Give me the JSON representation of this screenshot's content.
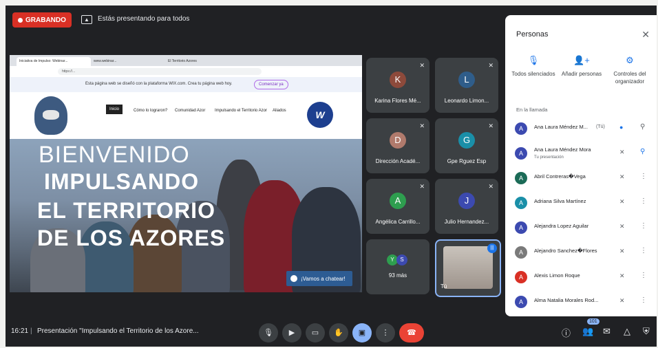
{
  "topbar": {
    "recording_label": "GRABANDO",
    "presenting_text": "Estás presentando para todos"
  },
  "slide": {
    "browser_tabs": [
      "Iniciativa de Impulso: Webinar...",
      "www.webinar...",
      "El Territorio Azores"
    ],
    "wix_banner": "Esta página web se diseñó con la plataforma WIX.com. Crea tu página web hoy.",
    "wix_button": "Comenzar ya",
    "nav": [
      "Inicio",
      "Cómo lo lograron?",
      "Comunidad Azor",
      "Impulsando el Territorio Azor",
      "Aliados"
    ],
    "hero_lines": [
      "BIENVENIDO",
      "IMPULSANDO",
      "EL TERRITORIO",
      "DE LOS AZORES"
    ],
    "chat_label": "¡Vamos a chatear!"
  },
  "tiles": [
    {
      "initial": "K",
      "name": "Karina Flores Mé...",
      "color": "#8d4a3b"
    },
    {
      "initial": "L",
      "name": "Leonardo Limon...",
      "color": "#2f5d8a"
    },
    {
      "initial": "D",
      "name": "Dirección Acadé...",
      "color": "#b07a6c"
    },
    {
      "initial": "G",
      "name": "Gpe Rguez Esp",
      "color": "#1a8fa8"
    },
    {
      "initial": "A",
      "name": "Angélica Carrillo...",
      "color": "#2e9e4f"
    },
    {
      "initial": "J",
      "name": "Julio Hernandez...",
      "color": "#3c4ab0"
    }
  ],
  "more_tile": {
    "avatars": [
      "Y",
      "S"
    ],
    "label": "93 más"
  },
  "self_tile": {
    "label": "Tú"
  },
  "people_panel": {
    "title": "Personas",
    "actions": [
      {
        "icon": "mic-off-icon",
        "label": "Todos silenciados"
      },
      {
        "icon": "add-person-icon",
        "label": "Añadir personas"
      },
      {
        "icon": "host-controls-icon",
        "label": "Controles del organizador"
      }
    ],
    "section_label": "En la llamada",
    "people": [
      {
        "initial": "A",
        "name": "Ana Laura Méndez M...",
        "tag": "(Tú)",
        "sub": "",
        "color": "#3c4ab0"
      },
      {
        "initial": "A",
        "name": "Ana Laura Méndez Mora",
        "tag": "",
        "sub": "Tu presentación",
        "color": "#3c4ab0"
      },
      {
        "initial": "A",
        "name": "Abril Contreras�Vega",
        "tag": "",
        "sub": "",
        "color": "#1b6b57"
      },
      {
        "initial": "A",
        "name": "Adriana Silva Martínez",
        "tag": "",
        "sub": "",
        "color": "#1a8fa8"
      },
      {
        "initial": "A",
        "name": "Alejandra Lopez Aguilar",
        "tag": "",
        "sub": "",
        "color": "#3c4ab0"
      },
      {
        "initial": "A",
        "name": "Alejandro Sanchez�Flores",
        "tag": "",
        "sub": "",
        "color": "#7a7a7a"
      },
      {
        "initial": "A",
        "name": "Alexis Limon Roque",
        "tag": "",
        "sub": "",
        "color": "#d93025"
      },
      {
        "initial": "A",
        "name": "Alma Natalia Morales Rod...",
        "tag": "",
        "sub": "",
        "color": "#3c4ab0"
      }
    ]
  },
  "bottombar": {
    "time": "16:21",
    "separator": "|",
    "meeting_title": "Presentación \"Impulsando el Territorio de los Azore...",
    "participant_count": "101"
  }
}
